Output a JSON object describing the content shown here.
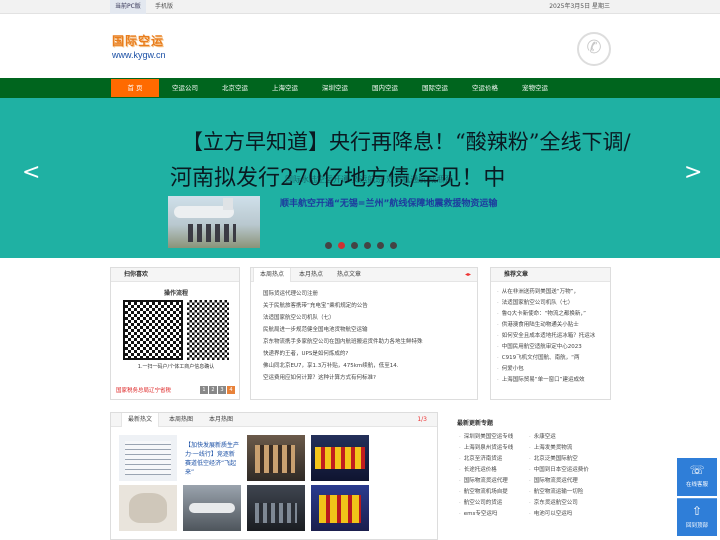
{
  "topbar": {
    "pc": "当前PC版",
    "mobile": "手机版",
    "date": "2025年3月5日 星期三"
  },
  "logo": {
    "cn": "国际空运",
    "url": "www.kygw.cn"
  },
  "nav": {
    "items": [
      "首 页",
      "空运公司",
      "北京空运",
      "上海空运",
      "深圳空运",
      "国内空运",
      "国际空运",
      "空运价格",
      "宠物空运"
    ]
  },
  "banner": {
    "headline1": "【立方早知道】央行再降息！“酸辣粉”全线下调/",
    "headline2": "河南拟发行270亿地方债/罕见！中",
    "ghost": "国际水陆空运开通·货运航班·双货机通航·成瓶颈",
    "subline": "顺丰航空开通“无锡=兰州”航线保障地震救援物资运输",
    "prev": "<",
    "next": ">"
  },
  "scan": {
    "title": "扫你喜欢",
    "qr_title": "操作流程",
    "qr_caption": "1.一扫一码户/个体工商户信息确认",
    "footer": "国家税务总局辽宁省税",
    "pages": [
      "1",
      "2",
      "3",
      "4"
    ]
  },
  "hot": {
    "tabs": [
      "本周热点",
      "本月热点",
      "热点文章"
    ],
    "items": [
      "国际货运代理公司注册",
      "关于民航旅客携带“充电宝”乘机规定的公告",
      "法适国家航空公司机队（七）",
      "民航局进一步规范健全国电池货物航空运输",
      "京东物流携手多家航空公司在国内航班搬运货件助力各地生鲜特殊",
      "快递界的王者，UPS是如何炼成的?",
      "佛山同北京EU7，享1.3万补贴，475km续航，低至14.",
      "空运费用应如何计算？这种计算方式有何标准?"
    ]
  },
  "recommend": {
    "title": "推荐文章",
    "items": [
      "从在非洲送药到美国送“万物”，",
      "法适国家航空公司机队（七）",
      "鲁Q大卡新使命：“物流之都换新，”",
      "供港澳食用陆生动物通关小贴士",
      "如何安全且成本适地托运冰箱？托运冰",
      "中国民用航空适航审定中心2023",
      "C919飞机文付国航、南航，“两",
      "何爱小包",
      "上海国际贸易“单一窗口”建运成效"
    ]
  },
  "photos": {
    "tabs": [
      "最新热文",
      "本周热图",
      "本月热图"
    ],
    "page": "1/3",
    "first_caption": "【加快发展新质生产力·一线行】竞逐新赛道低空经济“飞起来”"
  },
  "latest": {
    "title": "最新更新专题",
    "left": [
      "深圳到美国空运专线",
      "上海到泉州货运专线",
      "北京至济南货运",
      "长途托运价格",
      "国际物流货运代理",
      "航空物流机场自提",
      "航空公司的货运",
      "ems专空运吗"
    ],
    "right": [
      "永康空运",
      "上海发美货物流",
      "北京泛美国际航空",
      "中国到日本空运运费价",
      "国际物流货运代理",
      "航空物流运输一切险",
      "京东货运航空公司",
      "电池可以空运吗"
    ]
  },
  "float": {
    "service": "在线客服",
    "top": "回到顶部"
  },
  "colors": {
    "nav_green": "#00651e",
    "nav_home": "#ff6a00",
    "banner": "#1fb1a3",
    "float": "#2f7ed8"
  }
}
